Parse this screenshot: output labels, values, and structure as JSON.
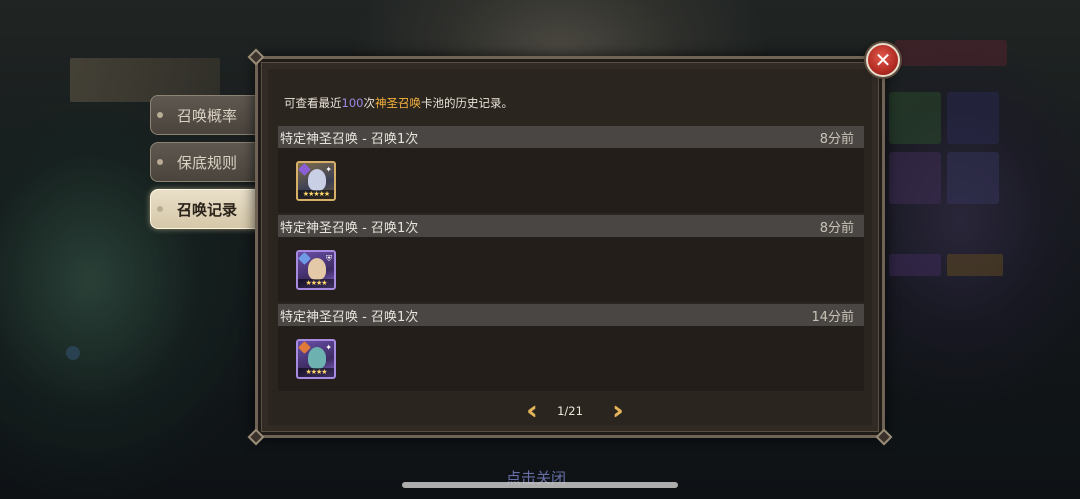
{
  "tabs": [
    {
      "label": "召唤概率",
      "active": false
    },
    {
      "label": "保底规则",
      "active": false
    },
    {
      "label": "召唤记录",
      "active": true
    }
  ],
  "intro": {
    "prefix": "可查看最近",
    "count": "100",
    "middle": "次",
    "pool": "神圣召唤",
    "suffix": "卡池的历史记录。"
  },
  "records": [
    {
      "title": "特定神圣召唤 - 召唤1次",
      "time": "8分前",
      "hero": {
        "icon": "hero-portrait-icon",
        "frame": "gold",
        "stars": 5
      }
    },
    {
      "title": "特定神圣召唤 - 召唤1次",
      "time": "8分前",
      "hero": {
        "icon": "hero-portrait-icon",
        "frame": "purple",
        "stars": 4
      }
    },
    {
      "title": "特定神圣召唤 - 召唤1次",
      "time": "14分前",
      "hero": {
        "icon": "hero-portrait-icon",
        "frame": "purple",
        "stars": 4
      }
    }
  ],
  "pager": {
    "page": "1/21",
    "prev_icon": "double-chevron-left-icon",
    "next_icon": "double-chevron-right-icon"
  },
  "close_icon": "close-icon",
  "footer": {
    "close_hint": "点击关闭"
  },
  "colors": {
    "highlight_count": "#9a8ae6",
    "highlight_pool": "#f4b23d",
    "close_red": "#c0392b",
    "arrow_gold": "#e3b45a"
  }
}
